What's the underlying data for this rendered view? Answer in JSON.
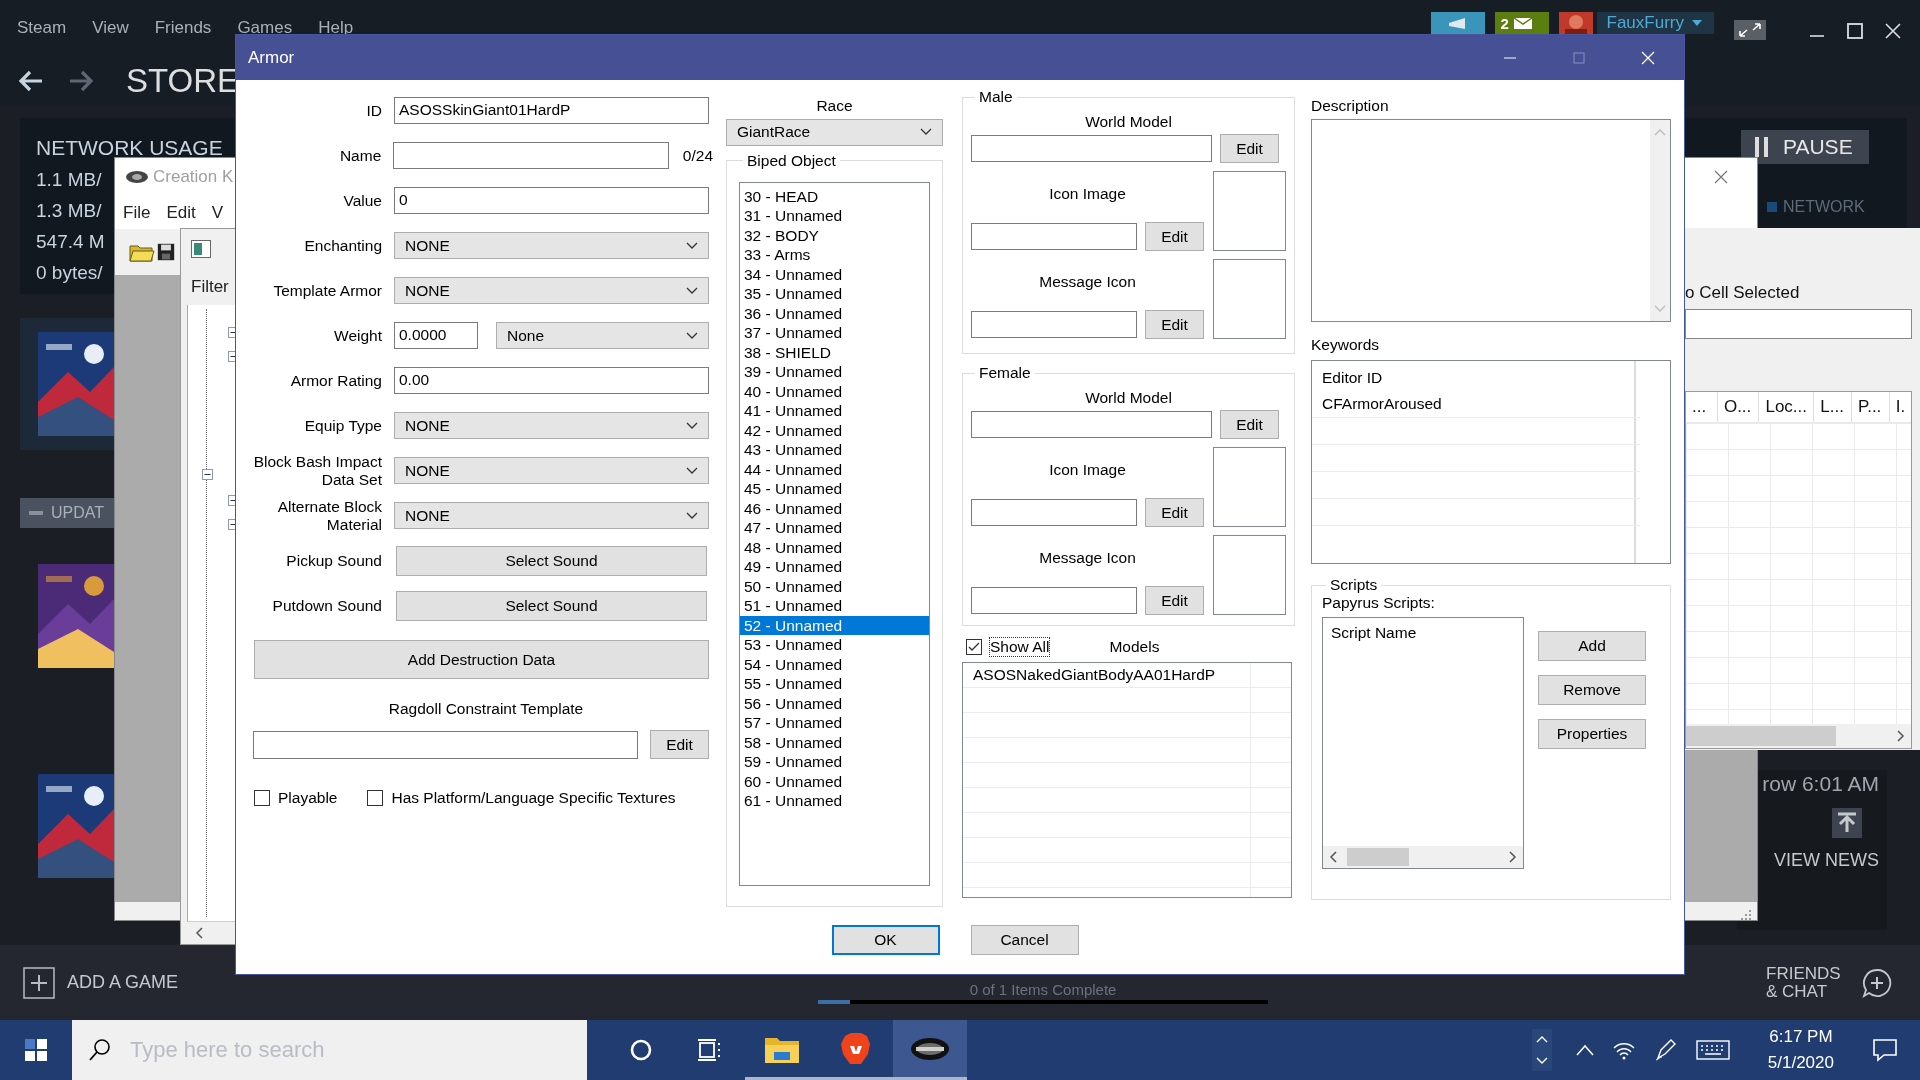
{
  "steam": {
    "menu": [
      "Steam",
      "View",
      "Friends",
      "Games",
      "Help"
    ],
    "notifications": "2",
    "user": "FauxFurry",
    "nav_title": "STORE",
    "downloads": {
      "heading": "NETWORK USAGE",
      "stats": [
        "1.1 MB/",
        "1.3 MB/",
        "547.4 M",
        "0 bytes/"
      ],
      "pause": "PAUSE",
      "network_label": "NETWORK"
    },
    "queue": [
      {
        "kind": "picture"
      },
      {
        "kind": "header",
        "text": "UPDAT"
      },
      {
        "kind": "picture"
      },
      {
        "kind": "picture",
        "time": "row 6:01 AM",
        "link": "VIEW NEWS"
      }
    ],
    "add_game": "ADD A GAME",
    "progress": {
      "text": "0 of 1 Items Complete",
      "level": 0.07
    },
    "friends": "FRIENDS & CHAT"
  },
  "creation_kit": {
    "title": "Creation K",
    "menu": [
      "File",
      "Edit",
      "V"
    ],
    "filter_label": "Filter"
  },
  "cell_view": {
    "status": "o Cell Selected",
    "columns": [
      "...",
      "O...",
      "Loc...",
      "L...",
      "P...",
      "I."
    ]
  },
  "armor_dialog": {
    "title": "Armor",
    "fields": [
      {
        "kind": "text",
        "label": "ID",
        "value": "ASOSSkinGiant01HardP"
      },
      {
        "kind": "text",
        "label": "Name",
        "counter": "0/24"
      },
      {
        "kind": "text",
        "label": "Value",
        "value": "0"
      },
      {
        "kind": "combo",
        "label": "Enchanting",
        "value": "NONE"
      },
      {
        "kind": "combo",
        "label": "Template Armor",
        "value": "NONE"
      },
      {
        "kind": "weight",
        "label": "Weight",
        "value": "0.0000",
        "option": "None"
      },
      {
        "kind": "text",
        "label": "Armor Rating",
        "value": "0.00"
      },
      {
        "kind": "combo",
        "label": "Equip Type",
        "value": "NONE"
      },
      {
        "kind": "combo",
        "label": "Block Bash Impact Data Set",
        "value": "NONE"
      },
      {
        "kind": "combo",
        "label": "Alternate Block Material",
        "value": "NONE"
      },
      {
        "kind": "button",
        "label": "Pickup Sound",
        "value": "Select Sound"
      },
      {
        "kind": "button",
        "label": "Putdown Sound",
        "value": "Select Sound"
      }
    ],
    "destruction_button": "Add Destruction Data",
    "ragdoll": {
      "label": "Ragdoll Constraint Template",
      "button": "Edit"
    },
    "checkboxes": [
      {
        "label": "Playable",
        "checked": false
      },
      {
        "label": "Has Platform/Language Specific Textures",
        "checked": false
      }
    ],
    "race": {
      "label": "Race",
      "value": "GiantRace"
    },
    "biped": {
      "label": "Biped Object",
      "items": [
        {
          "text": "30 - HEAD",
          "selected": false
        },
        {
          "text": "31 - Unnamed",
          "selected": false
        },
        {
          "text": "32 - BODY",
          "selected": false
        },
        {
          "text": "33 - Arms",
          "selected": false
        },
        {
          "text": "34 - Unnamed",
          "selected": false
        },
        {
          "text": "35 - Unnamed",
          "selected": false
        },
        {
          "text": "36 - Unnamed",
          "selected": false
        },
        {
          "text": "37 - Unnamed",
          "selected": false
        },
        {
          "text": "38 - SHIELD",
          "selected": false
        },
        {
          "text": "39 - Unnamed",
          "selected": false
        },
        {
          "text": "40 - Unnamed",
          "selected": false
        },
        {
          "text": "41 - Unnamed",
          "selected": false
        },
        {
          "text": "42 - Unnamed",
          "selected": false
        },
        {
          "text": "43 - Unnamed",
          "selected": false
        },
        {
          "text": "44 - Unnamed",
          "selected": false
        },
        {
          "text": "45 - Unnamed",
          "selected": false
        },
        {
          "text": "46 - Unnamed",
          "selected": false
        },
        {
          "text": "47 - Unnamed",
          "selected": false
        },
        {
          "text": "48 - Unnamed",
          "selected": false
        },
        {
          "text": "49 - Unnamed",
          "selected": false
        },
        {
          "text": "50 - Unnamed",
          "selected": false
        },
        {
          "text": "51 - Unnamed",
          "selected": false
        },
        {
          "text": "52 - Unnamed",
          "selected": true
        },
        {
          "text": "53 - Unnamed",
          "selected": false
        },
        {
          "text": "54 - Unnamed",
          "selected": false
        },
        {
          "text": "55 - Unnamed",
          "selected": false
        },
        {
          "text": "56 - Unnamed",
          "selected": false
        },
        {
          "text": "57 - Unnamed",
          "selected": false
        },
        {
          "text": "58 - Unnamed",
          "selected": false
        },
        {
          "text": "59 - Unnamed",
          "selected": false
        },
        {
          "text": "60 - Unnamed",
          "selected": false
        },
        {
          "text": "61 - Unnamed",
          "selected": false
        }
      ]
    },
    "genders": [
      {
        "label": "Male",
        "slots": [
          {
            "kind": "model",
            "label": "World Model",
            "button": "Edit"
          },
          {
            "label": "Icon Image",
            "button": "Edit"
          },
          {
            "label": "Message Icon",
            "button": "Edit"
          }
        ]
      },
      {
        "label": "Female",
        "slots": [
          {
            "kind": "model",
            "label": "World Model",
            "button": "Edit"
          },
          {
            "label": "Icon Image",
            "button": "Edit"
          },
          {
            "label": "Message Icon",
            "button": "Edit"
          }
        ]
      }
    ],
    "show_all": {
      "label": "Show All",
      "checked": true
    },
    "models": {
      "label": "Models",
      "rows": [
        "ASOSNakedGiantBodyAA01HardP"
      ]
    },
    "description": {
      "label": "Description"
    },
    "keywords": {
      "label": "Keywords",
      "column": "Editor ID",
      "rows": [
        "CFArmorAroused"
      ]
    },
    "scripts": {
      "label": "Scripts",
      "sublabel": "Papyrus Scripts:",
      "column": "Script Name",
      "buttons": [
        "Add",
        "Remove",
        "Properties"
      ]
    },
    "buttons": [
      "OK",
      "Cancel"
    ]
  },
  "taskbar": {
    "search_placeholder": "Type here to search",
    "time": "6:17 PM",
    "date": "5/1/2020",
    "apps": [
      {
        "kind": "folder",
        "running": true,
        "active": false
      },
      {
        "kind": "lion",
        "running": true,
        "active": false
      },
      {
        "kind": "disc",
        "running": true,
        "active": true
      }
    ]
  }
}
